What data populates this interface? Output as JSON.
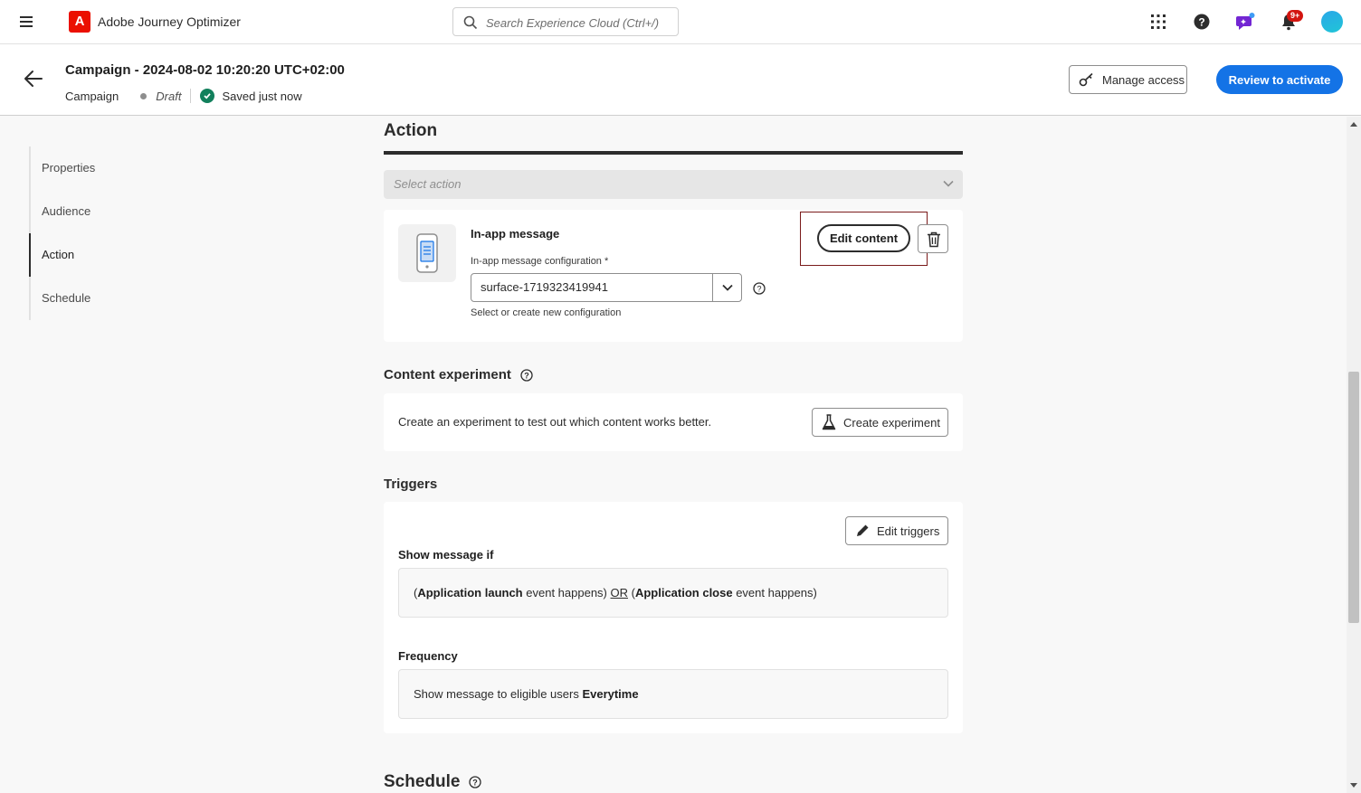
{
  "shell": {
    "app_name": "Adobe Journey Optimizer",
    "logo_letter": "A",
    "search_placeholder": "Search Experience Cloud (Ctrl+/)",
    "notification_count": "9+"
  },
  "header": {
    "title": "Campaign - 2024-08-02 10:20:20 UTC+02:00",
    "type": "Campaign",
    "status": "Draft",
    "saved": "Saved just now",
    "manage_access": "Manage access",
    "review": "Review to activate"
  },
  "nav": {
    "items": [
      {
        "label": "Properties"
      },
      {
        "label": "Audience"
      },
      {
        "label": "Action"
      },
      {
        "label": "Schedule"
      }
    ],
    "active": "Action"
  },
  "action": {
    "heading": "Action",
    "select_placeholder": "Select action",
    "channel_title": "In-app message",
    "config_label": "In-app message configuration",
    "config_required": "*",
    "config_value": "surface-1719323419941",
    "config_help": "Select or create new configuration",
    "edit_content": "Edit content"
  },
  "experiment": {
    "heading": "Content experiment",
    "text": "Create an experiment to test out which content works better.",
    "button": "Create experiment"
  },
  "triggers": {
    "heading": "Triggers",
    "edit_button": "Edit triggers",
    "show_label": "Show message if",
    "cond_open1": "(",
    "cond_event1": "Application launch",
    "cond_mid1": " event happens) ",
    "cond_or": "OR",
    "cond_open2": " (",
    "cond_event2": "Application close",
    "cond_mid2": " event happens)",
    "frequency_label": "Frequency",
    "freq_text": "Show message to eligible users ",
    "freq_value": "Everytime"
  },
  "schedule": {
    "heading": "Schedule"
  },
  "colors": {
    "accent": "#1473e6",
    "brand": "#eb1000",
    "success": "#12805c",
    "highlight_frame": "#7a1a1a"
  }
}
